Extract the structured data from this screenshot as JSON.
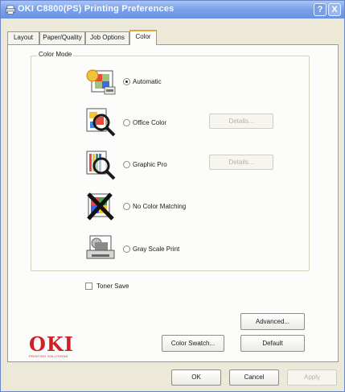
{
  "window": {
    "title": "OKI C8800(PS) Printing Preferences",
    "help_button": "?",
    "close_button": "X"
  },
  "tabs": [
    {
      "label": "Layout",
      "active": false
    },
    {
      "label": "Paper/Quality",
      "active": false
    },
    {
      "label": "Job Options",
      "active": false
    },
    {
      "label": "Color",
      "active": true
    }
  ],
  "color_mode": {
    "group_label": "Color Mode",
    "options": [
      {
        "label": "Automatic",
        "selected": true,
        "icon": "automatic-color-icon"
      },
      {
        "label": "Office Color",
        "selected": false,
        "icon": "office-color-magnifier-icon",
        "details_button": "Details...",
        "details_enabled": false
      },
      {
        "label": "Graphic Pro",
        "selected": false,
        "icon": "graphic-pro-magnifier-icon",
        "details_button": "Details...",
        "details_enabled": false
      },
      {
        "label": "No Color Matching",
        "selected": false,
        "icon": "no-color-matching-icon"
      },
      {
        "label": "Gray Scale Print",
        "selected": false,
        "icon": "grayscale-print-icon"
      }
    ]
  },
  "toner_save": {
    "label": "Toner Save",
    "checked": false
  },
  "buttons": {
    "advanced": "Advanced...",
    "color_swatch": "Color Swatch...",
    "default": "Default",
    "ok": "OK",
    "cancel": "Cancel",
    "apply": "Apply"
  },
  "logo": {
    "name": "OKI",
    "tagline": "PRINTING SOLUTIONS"
  },
  "colors": {
    "title_bar": "#7ca2ea",
    "logo_red": "#d21f26",
    "active_tab_accent": "#e8a33a",
    "disabled_text": "#b4b3a8"
  }
}
